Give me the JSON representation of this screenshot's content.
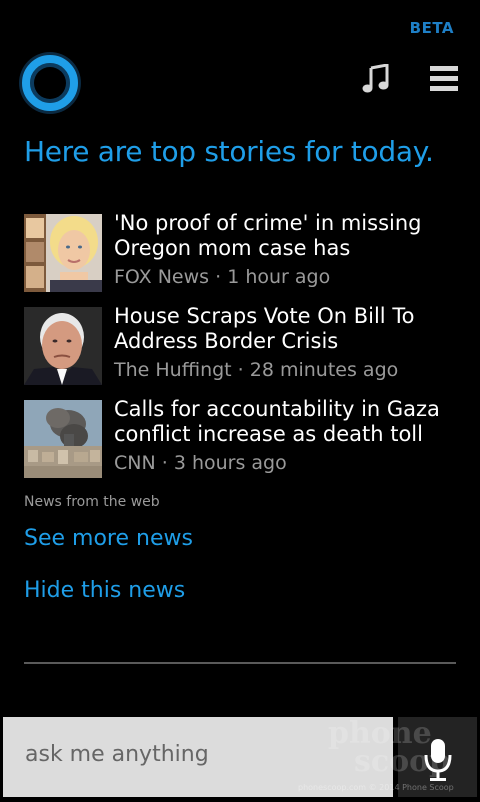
{
  "header": {
    "beta_label": "BETA",
    "cortana_icon": "cortana-ring-icon",
    "music_icon": "music-note-icon",
    "menu_icon": "hamburger-menu-icon"
  },
  "headline": "Here are top stories for today.",
  "stories": [
    {
      "title": "'No proof of crime' in missing Oregon mom case has",
      "source": "FOX News",
      "time": "1 hour ago",
      "thumb_icon": "news-thumbnail-woman"
    },
    {
      "title": "House Scraps Vote On Bill To Address Border Crisis",
      "source": "The Huffingt",
      "time": "28 minutes ago",
      "thumb_icon": "news-thumbnail-politician"
    },
    {
      "title": "Calls for accountability in Gaza conflict increase as death toll",
      "source": "CNN",
      "time": "3 hours ago",
      "thumb_icon": "news-thumbnail-smoke"
    }
  ],
  "meta_separator": " · ",
  "source_note": "News from the web",
  "links": {
    "see_more": "See more news",
    "hide": "Hide this news"
  },
  "search": {
    "placeholder": "ask me anything",
    "value": "",
    "mic_icon": "microphone-icon"
  },
  "watermark": {
    "text_line1": "phone",
    "text_line2": "scoop",
    "caption": "phonescoop.com  © 2014 Phone Scoop"
  },
  "colors": {
    "accent": "#1f9ee8",
    "background": "#000000",
    "meta_text": "#9a9a9a"
  }
}
